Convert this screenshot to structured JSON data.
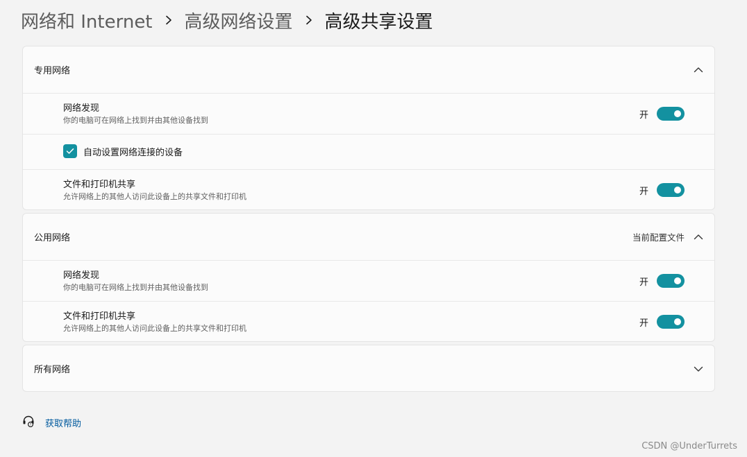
{
  "breadcrumb": {
    "items": [
      "网络和 Internet",
      "高级网络设置"
    ],
    "current": "高级共享设置"
  },
  "private_network": {
    "title": "专用网络",
    "network_discovery": {
      "title": "网络发现",
      "description": "你的电脑可在网络上找到并由其他设备找到",
      "state": "开",
      "enabled": true
    },
    "auto_setup": {
      "label": "自动设置网络连接的设备",
      "checked": true
    },
    "file_printer_sharing": {
      "title": "文件和打印机共享",
      "description": "允许网络上的其他人访问此设备上的共享文件和打印机",
      "state": "开",
      "enabled": true
    }
  },
  "public_network": {
    "title": "公用网络",
    "profile_note": "当前配置文件",
    "network_discovery": {
      "title": "网络发现",
      "description": "你的电脑可在网络上找到并由其他设备找到",
      "state": "开",
      "enabled": true
    },
    "file_printer_sharing": {
      "title": "文件和打印机共享",
      "description": "允许网络上的其他人访问此设备上的共享文件和打印机",
      "state": "开",
      "enabled": true
    }
  },
  "all_networks": {
    "title": "所有网络"
  },
  "help": {
    "label": "获取帮助"
  },
  "watermark": "CSDN @UnderTurrets",
  "colors": {
    "accent": "#1391a0",
    "background": "#f3f3f3",
    "panel": "#fbfbfb",
    "link": "#005a9e"
  }
}
